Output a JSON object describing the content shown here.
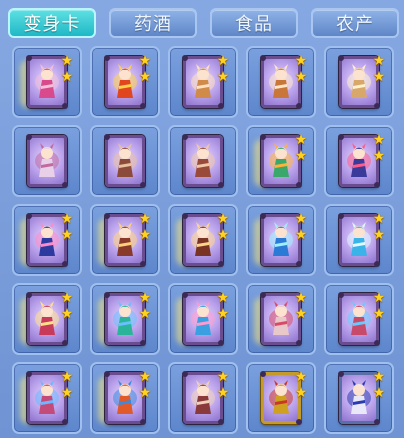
{
  "tabs": [
    {
      "label": "变身卡",
      "active": true
    },
    {
      "label": "药酒",
      "active": false
    },
    {
      "label": "食品",
      "active": false
    },
    {
      "label": "农产",
      "active": false
    }
  ],
  "colors": {
    "active_tab": "#1fb8c6",
    "inactive_tab": "#6f93d3",
    "slot_bg": "#6d94d6",
    "star": "#ffd21f",
    "card_inner": "#b8a0ea"
  },
  "star_glyph": "★",
  "slots": [
    {
      "figure": "purple-dancer",
      "color": "#d94a8c",
      "accent": "#f3c0d8",
      "frame": "purple",
      "glow": true,
      "stars": 2
    },
    {
      "figure": "fire-monkey",
      "color": "#e0461f",
      "accent": "#ffd24a",
      "frame": "purple",
      "glow": false,
      "stars": 2
    },
    {
      "figure": "fox-spirit",
      "color": "#d08a4a",
      "accent": "#ffe0c0",
      "frame": "purple",
      "glow": false,
      "stars": 2
    },
    {
      "figure": "fox-spirit-2",
      "color": "#c9763a",
      "accent": "#ffe5c8",
      "frame": "purple",
      "glow": false,
      "stars": 2
    },
    {
      "figure": "monkey-monk",
      "color": "#d8a86a",
      "accent": "#fff1cc",
      "frame": "purple",
      "glow": false,
      "stars": 2
    },
    {
      "figure": "rabbit-maiden",
      "color": "#e8d0e8",
      "accent": "#c06aa0",
      "frame": "purple",
      "glow": false,
      "stars": 0
    },
    {
      "figure": "bat-demon",
      "color": "#8c4a3a",
      "accent": "#e8c0a0",
      "frame": "purple",
      "glow": false,
      "stars": 0
    },
    {
      "figure": "bat-demon-2",
      "color": "#9a4a3a",
      "accent": "#f0c8a8",
      "frame": "purple",
      "glow": false,
      "stars": 0
    },
    {
      "figure": "dragon",
      "color": "#3aa86a",
      "accent": "#ffb23a",
      "frame": "purple",
      "glow": true,
      "stars": 2
    },
    {
      "figure": "ice-horse",
      "color": "#3a3a9a",
      "accent": "#ff5c8a",
      "frame": "purple",
      "glow": false,
      "stars": 2
    },
    {
      "figure": "blue-horse",
      "color": "#2d3ba0",
      "accent": "#ff8ac8",
      "frame": "purple",
      "glow": true,
      "stars": 2
    },
    {
      "figure": "warrior",
      "color": "#8a3a2a",
      "accent": "#ffcf7a",
      "frame": "purple",
      "glow": true,
      "stars": 2
    },
    {
      "figure": "warrior-2",
      "color": "#7a3424",
      "accent": "#ffd58a",
      "frame": "purple",
      "glow": true,
      "stars": 2
    },
    {
      "figure": "water-spirit",
      "color": "#2a7ad6",
      "accent": "#9ff0ff",
      "frame": "purple",
      "glow": true,
      "stars": 2
    },
    {
      "figure": "ice-crane",
      "color": "#3ab4e8",
      "accent": "#e0f8ff",
      "frame": "purple",
      "glow": false,
      "stars": 2
    },
    {
      "figure": "sage-warrior",
      "color": "#c83a5a",
      "accent": "#ffe08a",
      "frame": "purple",
      "glow": true,
      "stars": 2
    },
    {
      "figure": "peacock",
      "color": "#2ab49a",
      "accent": "#6ac0ff",
      "frame": "purple",
      "glow": true,
      "stars": 2
    },
    {
      "figure": "butterfly-fairy",
      "color": "#3aa0e0",
      "accent": "#ff9ad0",
      "frame": "purple",
      "glow": true,
      "stars": 2
    },
    {
      "figure": "rabbit-demon",
      "color": "#e8c8c8",
      "accent": "#d84a6a",
      "frame": "purple",
      "glow": true,
      "stars": 2
    },
    {
      "figure": "phoenix",
      "color": "#c84a6a",
      "accent": "#6ac8ff",
      "frame": "purple",
      "glow": false,
      "stars": 2
    },
    {
      "figure": "phoenix-2",
      "color": "#c44a7a",
      "accent": "#6ab8ff",
      "frame": "purple",
      "glow": true,
      "stars": 2
    },
    {
      "figure": "sun-warrior",
      "color": "#e05a2a",
      "accent": "#3a8ae0",
      "frame": "purple",
      "glow": true,
      "stars": 2
    },
    {
      "figure": "bat-demon-3",
      "color": "#8a3a3a",
      "accent": "#f0d0b8",
      "frame": "purple",
      "glow": false,
      "stars": 2
    },
    {
      "figure": "golden-monkey",
      "color": "#d0a020",
      "accent": "#c8372a",
      "frame": "gold",
      "glow": false,
      "stars": 2
    },
    {
      "figure": "silver-knight",
      "color": "#e8e8f8",
      "accent": "#2a3ab0",
      "frame": "silver",
      "glow": false,
      "stars": 2
    }
  ]
}
